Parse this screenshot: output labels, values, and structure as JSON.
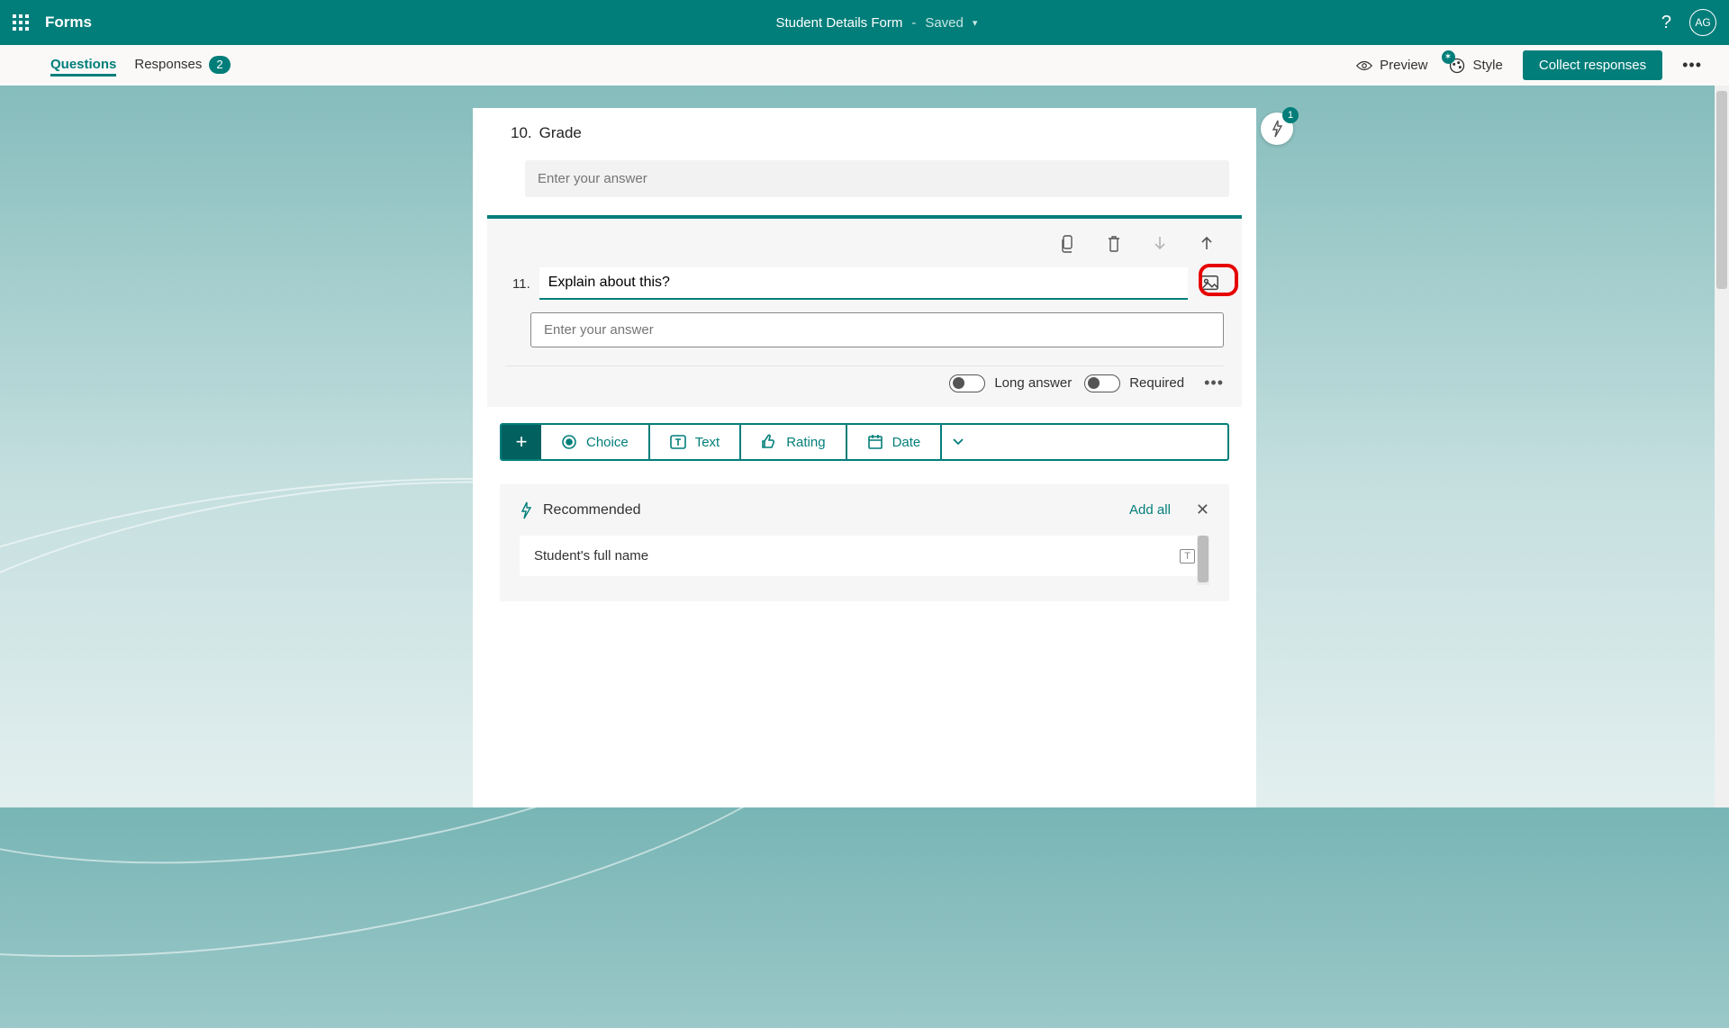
{
  "header": {
    "app_name": "Forms",
    "title": "Student Details Form",
    "status": "Saved",
    "avatar": "AG"
  },
  "subheader": {
    "tab_questions": "Questions",
    "tab_responses": "Responses",
    "responses_count": "2",
    "preview": "Preview",
    "style": "Style",
    "collect": "Collect responses"
  },
  "suggestions_fab_count": "1",
  "q10": {
    "number": "10.",
    "title": "Grade",
    "placeholder": "Enter your answer"
  },
  "q11": {
    "number": "11.",
    "text_value": "Explain about this?",
    "answer_placeholder": "Enter your answer",
    "long_answer_label": "Long answer",
    "required_label": "Required"
  },
  "add_bar": {
    "choice": "Choice",
    "text": "Text",
    "rating": "Rating",
    "date": "Date"
  },
  "recommended": {
    "title": "Recommended",
    "add_all": "Add all",
    "items": [
      "Student's full name"
    ]
  }
}
